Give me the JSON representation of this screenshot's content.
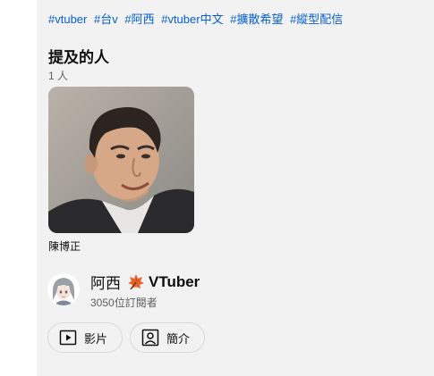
{
  "hashtags": [
    "#vtuber",
    "#台v",
    "#阿西",
    "#vtuber中文",
    "#擴散希望",
    "#縱型配信"
  ],
  "people_section": {
    "title": "提及的人",
    "count": "1 人",
    "people": [
      {
        "name": "陳博正"
      }
    ]
  },
  "channel": {
    "name": "阿西",
    "badge_icon": "maple-leaf-icon",
    "badge_text": "VTuber",
    "subscribers": "3050位訂閱者"
  },
  "buttons": {
    "videos_label": "影片",
    "about_label": "簡介"
  },
  "colors": {
    "link": "#065fd4",
    "panel_bg": "#f2f2f2",
    "text_primary": "#0f0f0f",
    "text_secondary": "#606060"
  }
}
